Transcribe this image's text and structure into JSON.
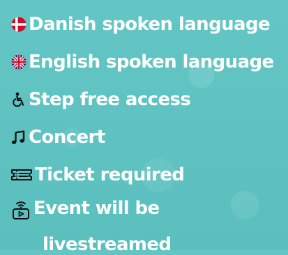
{
  "features": [
    {
      "label": "Danish spoken language",
      "icon": "denmark-flag-icon"
    },
    {
      "label": "English spoken language",
      "icon": "uk-flag-icon"
    },
    {
      "label": "Step free access",
      "icon": "wheelchair-icon"
    },
    {
      "label": "Concert",
      "icon": "music-note-icon"
    },
    {
      "label": "Ticket required",
      "icon": "ticket-icon"
    },
    {
      "label_line1": "Event will be",
      "label_line2": "livestreamed",
      "icon": "livestream-icon"
    }
  ],
  "colors": {
    "background": "#5fc3c2",
    "text": "#ffffff",
    "danish_red": "#c8102e",
    "uk_blue": "#012169",
    "uk_red": "#c8102e"
  }
}
